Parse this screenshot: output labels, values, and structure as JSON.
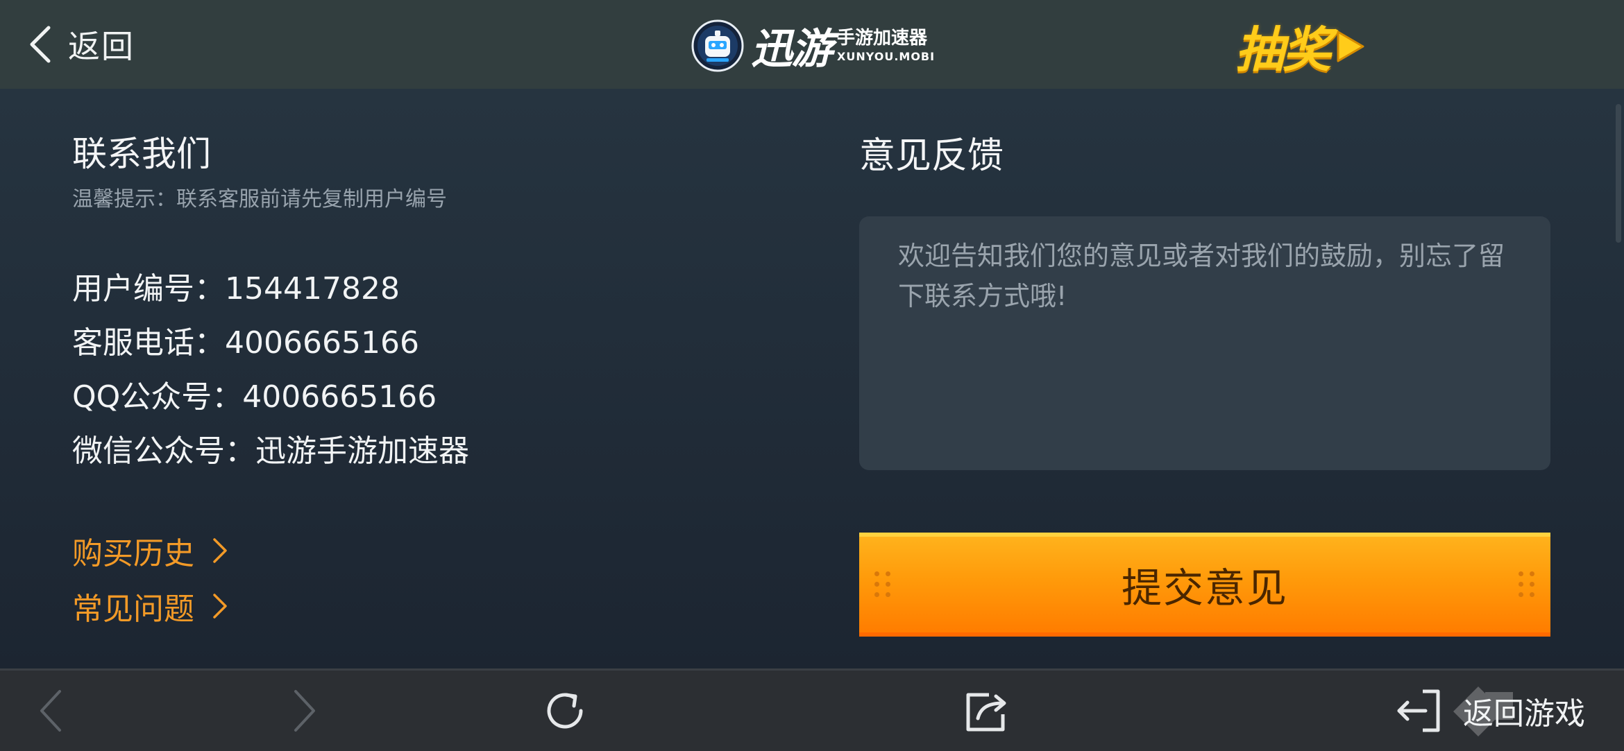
{
  "header": {
    "back_label": "返回",
    "brand_main": "迅游",
    "brand_sub": "手游加速器",
    "brand_url": "XUNYOU.MOBI",
    "lottery_label": "抽奖"
  },
  "contact": {
    "title": "联系我们",
    "tip": "温馨提示：联系客服前请先复制用户编号",
    "rows": [
      {
        "key": "用户编号：",
        "value": "154417828"
      },
      {
        "key": "客服电话：",
        "value": "4006665166"
      },
      {
        "key": "QQ公众号：",
        "value": "4006665166"
      },
      {
        "key": "微信公众号：",
        "value": "迅游手游加速器"
      }
    ],
    "links": [
      {
        "label": "购买历史"
      },
      {
        "label": "常见问题"
      }
    ]
  },
  "feedback": {
    "title": "意见反馈",
    "placeholder": "欢迎告知我们您的意见或者对我们的鼓励，别忘了留下联系方式哦!",
    "value": "",
    "submit_label": "提交意见"
  },
  "bottombar": {
    "back_game_label": "返回游戏"
  },
  "colors": {
    "header_bg": "#323e3f",
    "accent_orange": "#f39a27",
    "submit_orange": "#ff9a0a",
    "lottery_yellow": "#ffcc1a",
    "bottombar_bg": "#2c2f33"
  },
  "icons": {
    "back": "chevron-left-icon",
    "lottery_arrow": "play-triangle-icon",
    "link_arrow": "chevron-right-icon",
    "nav_back": "chevron-left-icon",
    "nav_forward": "chevron-right-icon",
    "refresh": "refresh-icon",
    "share": "share-icon",
    "exit": "exit-arrow-icon"
  }
}
